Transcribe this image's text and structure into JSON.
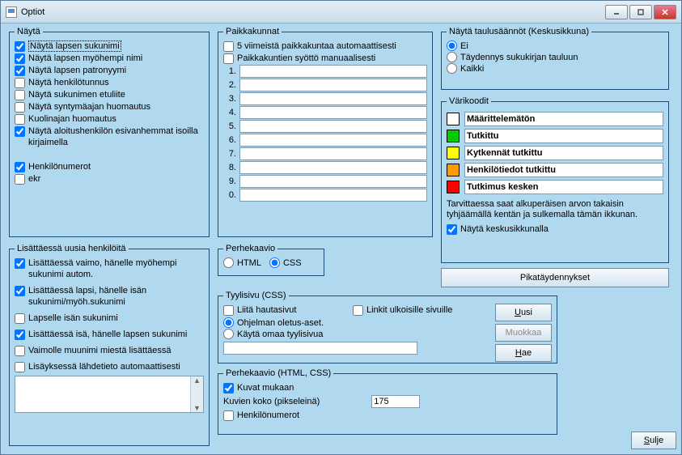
{
  "window": {
    "title": "Optiot"
  },
  "nayta": {
    "legend": "Näytä",
    "items": [
      {
        "label": "Näytä lapsen sukunimi",
        "checked": true,
        "dotted": true
      },
      {
        "label": "Näytä lapsen myöhempi nimi",
        "checked": true
      },
      {
        "label": "Näytä lapsen patronyymi",
        "checked": true
      },
      {
        "label": "Näytä henkilötunnus",
        "checked": false
      },
      {
        "label": "Näytä sukunimen etuliite",
        "checked": false
      },
      {
        "label": "Näytä syntymäajan huomautus",
        "checked": false
      },
      {
        "label": "Kuolinajan huomautus",
        "checked": false
      },
      {
        "label": "Näytä aloitushenkilön esivanhemmat isoilla kirjaimella",
        "checked": true
      }
    ],
    "extra": [
      {
        "label": "Henkilönumerot",
        "checked": true
      },
      {
        "label": "ekr",
        "checked": false
      }
    ]
  },
  "lisattaessa": {
    "legend": "Lisättäessä uusia henkilöitä",
    "items": [
      {
        "label": "Lisättäessä vaimo, hänelle myöhempi sukunimi autom.",
        "checked": true
      },
      {
        "label": "Lisättäessä lapsi, hänelle isän sukunimi/myöh.sukunimi",
        "checked": true
      },
      {
        "label": "Lapselle isän sukunimi",
        "checked": false
      },
      {
        "label": "Lisättäessä isä, hänelle lapsen sukunimi",
        "checked": true
      },
      {
        "label": "Vaimolle muunimi miestä lisättäessä",
        "checked": false
      },
      {
        "label": "Lisäyksessä lähdetieto automaattisesti",
        "checked": false
      }
    ]
  },
  "paikkakunnat": {
    "legend": "Paikkakunnat",
    "auto5": {
      "label": "5 viimeistä paikkakuntaa automaattisesti",
      "checked": false
    },
    "manual": {
      "label": "Paikkakuntien syöttö manuaalisesti",
      "checked": false
    },
    "nums": [
      "1.",
      "2.",
      "3.",
      "4.",
      "5.",
      "6.",
      "7.",
      "8.",
      "9.",
      "0."
    ]
  },
  "perhekaavio": {
    "legend": "Perhekaavio",
    "html": "HTML",
    "css": "CSS"
  },
  "tyylisivu": {
    "legend": "Tyylisivu (CSS)",
    "liita": {
      "label": "Liitä hautasivut",
      "checked": false
    },
    "linkit": {
      "label": "Linkit ulkoisille sivuille",
      "checked": false
    },
    "r1": "Ohjelman oletus-aset.",
    "r2": "Käytä omaa tyylisivua",
    "uusi": "Uusi",
    "muokkaa": "Muokkaa",
    "hae": "Hae"
  },
  "perhekaavio2": {
    "legend": "Perhekaavio (HTML, CSS)",
    "kuvat": {
      "label": "Kuvat mukaan",
      "checked": true
    },
    "koko_label": "Kuvien koko (pikseleinä)",
    "koko_value": "175",
    "henk": {
      "label": "Henkilönumerot",
      "checked": false
    }
  },
  "taulusaannot": {
    "legend": "Näytä taulusäännöt (Keskusikkuna)",
    "r1": "Ei",
    "r2": "Täydennys sukukirjan tauluun",
    "r3": "Kaikki"
  },
  "varikoodit": {
    "legend": "Värikoodit",
    "rows": [
      {
        "color": "#ffffff",
        "label": "Määrittelemätön"
      },
      {
        "color": "#00cc00",
        "label": "Tutkittu"
      },
      {
        "color": "#ffff00",
        "label": "Kytkennät tutkittu"
      },
      {
        "color": "#ff9900",
        "label": "Henkilötiedot tutkittu"
      },
      {
        "color": "#ff0000",
        "label": "Tutkimus kesken"
      }
    ],
    "note": "Tarvittaessa saat alkuperäisen arvon takaisin tyhjäämällä kentän ja sulkemalla tämän ikkunan.",
    "keskus": {
      "label": "Näytä keskusikkunalla",
      "checked": true
    }
  },
  "pika": "Pikatäydennykset",
  "sulje": "Sulje",
  "underline_letters": {
    "uusi": "U",
    "hae": "H",
    "sulje": "S"
  }
}
